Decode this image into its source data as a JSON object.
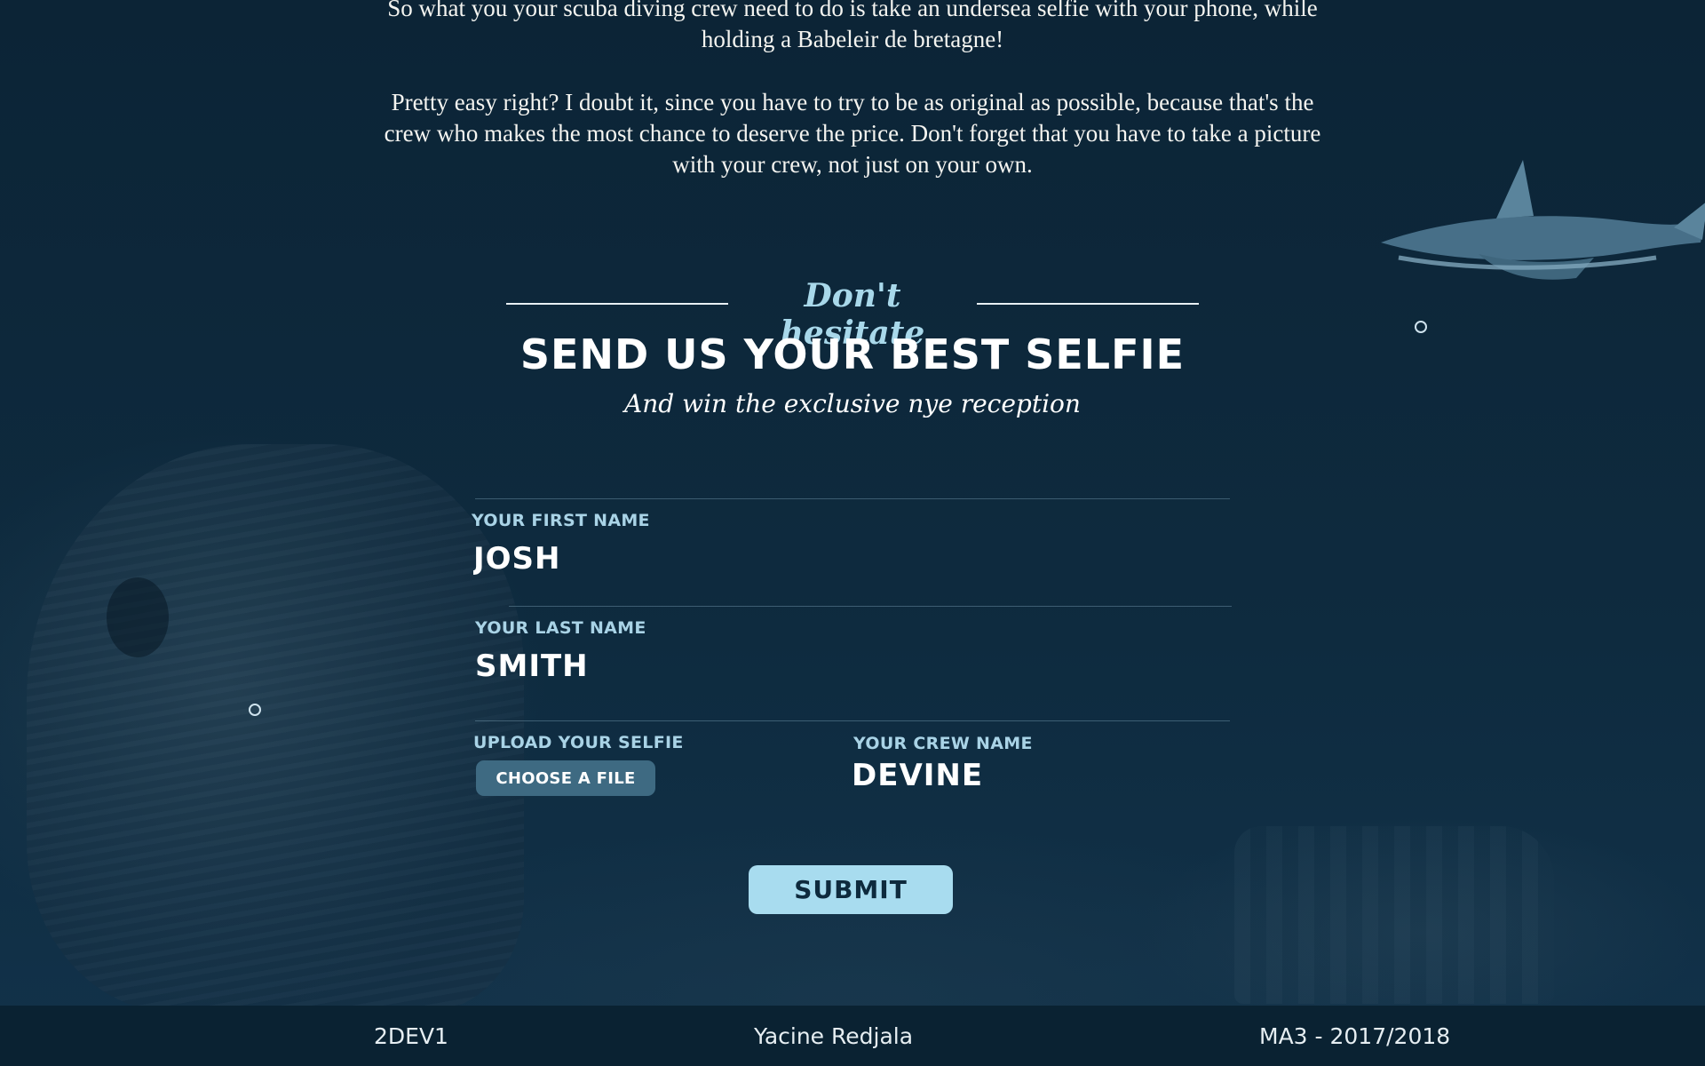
{
  "intro": {
    "paragraph1": "So what you your scuba diving crew need to do is take an undersea selfie with your phone, while holding a Babeleir de bretagne!",
    "paragraph2": "Pretty easy right? I doubt it, since you have to try to be as original as possible, because that's the crew who makes the most chance to deserve the price. Don't forget that you have to take a picture with your crew, not just on your own."
  },
  "heading": {
    "kicker": "Don't hesitate",
    "title": "SEND US YOUR BEST SELFIE",
    "subtitle": "And win the exclusive nye reception"
  },
  "form": {
    "first_name": {
      "label": "YOUR FIRST NAME",
      "value": "JOSH"
    },
    "last_name": {
      "label": "YOUR LAST NAME",
      "value": "SMITH"
    },
    "selfie": {
      "label": "UPLOAD YOUR SELFIE",
      "button": "CHOOSE A FILE"
    },
    "crew_name": {
      "label": "YOUR CREW NAME",
      "value": "DEVINE"
    },
    "submit": "SUBMIT"
  },
  "footer": {
    "left": "2DEV1",
    "center": "Yacine Redjala",
    "right": "MA3 - 2017/2018"
  },
  "colors": {
    "background": "#0e2a3d",
    "accent": "#a8dcef",
    "label": "#a9d3e6",
    "file_button": "#3e6a82"
  }
}
